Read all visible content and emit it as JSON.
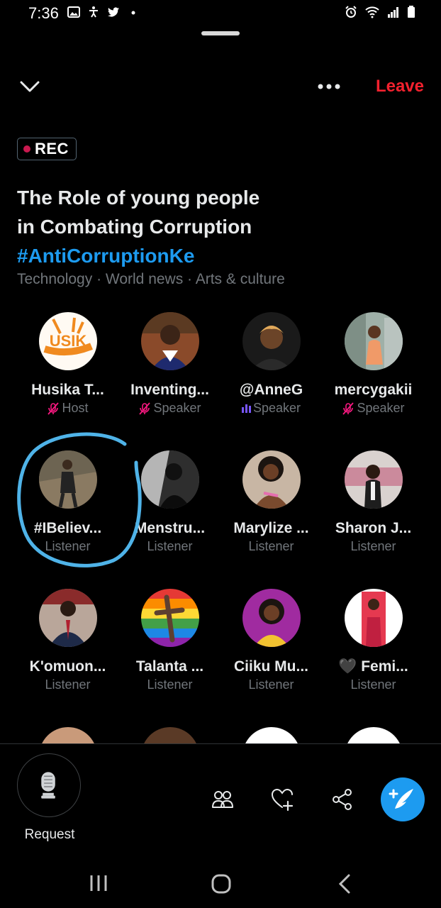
{
  "status_bar": {
    "time": "7:36"
  },
  "header": {
    "leave_label": "Leave"
  },
  "space": {
    "rec_label": "REC",
    "title_line1": "The Role of young people",
    "title_line2": "in Combating Corruption",
    "hashtag": "#AntiCorruptionKe",
    "topics": "Technology · World news · Arts & culture"
  },
  "participants": [
    {
      "name": "Husika T...",
      "role": "Host",
      "mic": "muted"
    },
    {
      "name": "Inventing...",
      "role": "Speaker",
      "mic": "muted"
    },
    {
      "name": "@AnneG",
      "role": "Speaker",
      "mic": "talking"
    },
    {
      "name": "mercygakii",
      "role": "Speaker",
      "mic": "muted"
    },
    {
      "name": "#IBeliev...",
      "role": "Listener"
    },
    {
      "name": "Menstru...",
      "role": "Listener"
    },
    {
      "name": "Marylize ...",
      "role": "Listener"
    },
    {
      "name": "Sharon J...",
      "role": "Listener"
    },
    {
      "name": "K'omuon...",
      "role": "Listener"
    },
    {
      "name": "Talanta ...",
      "role": "Listener"
    },
    {
      "name": "Ciiku Mu...",
      "role": "Listener"
    },
    {
      "name": "🖤 Femi...",
      "role": "Listener"
    }
  ],
  "bottom_bar": {
    "request_label": "Request"
  },
  "colors": {
    "accent_blue": "#1d9bf0",
    "leave_red": "#f4212e",
    "rec_dot": "#c9194f",
    "muted_pink": "#f91880",
    "talking_purple": "#7856ff",
    "annotation_circle": "#4fb3e8"
  },
  "icons": [
    "gallery-icon",
    "accessibility-icon",
    "twitter-bird-icon",
    "alarm-icon",
    "wifi-icon",
    "signal-icon",
    "battery-icon",
    "chevron-down-icon",
    "more-icon",
    "microphone-icon",
    "people-icon",
    "heart-plus-icon",
    "share-icon",
    "compose-icon",
    "recents-icon",
    "home-icon",
    "back-icon"
  ]
}
